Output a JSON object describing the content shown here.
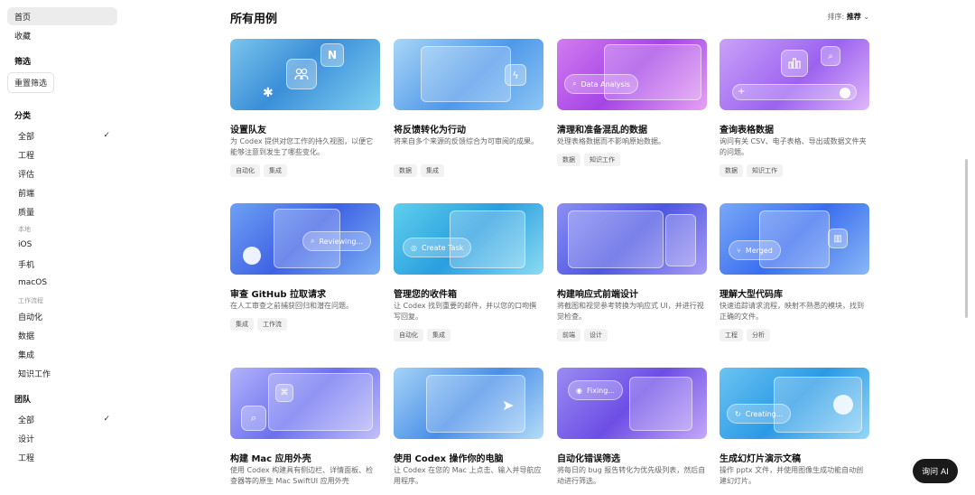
{
  "sidebar": {
    "home": "首页",
    "favorites": "收藏",
    "filter_title": "筛选",
    "reset_filter": "重置筛选",
    "category_title": "分类",
    "cat_all": "全部",
    "cat_engineering": "工程",
    "cat_eval": "评估",
    "cat_frontend": "前端",
    "cat_quality": "质量",
    "local_label": "本地",
    "ios": "iOS",
    "mobile": "手机",
    "macos": "macOS",
    "workflow_label": "工作流程",
    "automation": "自动化",
    "data": "数据",
    "integration": "集成",
    "knowledge": "知识工作",
    "team_title": "团队",
    "team_all": "全部",
    "design": "设计",
    "team_engineering": "工程",
    "check": "✓"
  },
  "header": {
    "title": "所有用例",
    "sort_label": "排序:",
    "sort_value": "推荐",
    "sort_chevron": "chevron-down-icon"
  },
  "cards": [
    {
      "title": "设置队友",
      "desc": "为 Codex 提供对您工作的持久视图，以便它能够注意到发生了哪些变化。",
      "tags": [
        "自动化",
        "集成"
      ]
    },
    {
      "title": "将反馈转化为行动",
      "desc": "将来自多个来源的反馈综合为可审阅的成果。",
      "tags": [
        "数据",
        "集成"
      ]
    },
    {
      "title": "清理和准备混乱的数据",
      "desc": "处理表格数据而不影响原始数据。",
      "tags": [
        "数据",
        "知识工作"
      ],
      "pill": "Data Analysis"
    },
    {
      "title": "查询表格数据",
      "desc": "询问有关 CSV、电子表格、导出或数据文件夹的问题。",
      "tags": [
        "数据",
        "知识工作"
      ]
    },
    {
      "title": "审查 GitHub 拉取请求",
      "desc": "在人工审查之前捕获回归和潜在问题。",
      "tags": [
        "集成",
        "工作流"
      ],
      "pill": "Reviewing..."
    },
    {
      "title": "管理您的收件箱",
      "desc": "让 Codex 找到重要的邮件，并以您的口吻撰写回复。",
      "tags": [
        "自动化",
        "集成"
      ],
      "pill": "Create Task"
    },
    {
      "title": "构建响应式前端设计",
      "desc": "将截图和视觉参考转换为响应式 UI，并进行视觉检查。",
      "tags": [
        "前端",
        "设计"
      ]
    },
    {
      "title": "理解大型代码库",
      "desc": "快速追踪请求流程，映射不熟悉的模块，找到正确的文件。",
      "tags": [
        "工程",
        "分析"
      ],
      "pill": "Merged"
    },
    {
      "title": "构建 Mac 应用外壳",
      "desc": "使用 Codex 构建具有侧边栏、详情面板、检查器等的原生 Mac SwiftUI 应用外壳",
      "tags": []
    },
    {
      "title": "使用 Codex 操作你的电脑",
      "desc": "让 Codex 在您的 Mac 上点击、输入并导航应用程序。",
      "tags": []
    },
    {
      "title": "自动化错误筛选",
      "desc": "将每日的 bug 报告转化为优先级列表，然后自动进行筛选。",
      "tags": [],
      "pill": "Fixing..."
    },
    {
      "title": "生成幻灯片演示文稿",
      "desc": "操作 pptx 文件，并使用图像生成功能自动创建幻灯片。",
      "tags": [],
      "pill": "Creating..."
    }
  ],
  "ask_ai": "询问 AI",
  "colors": {
    "thumb1": "#4aa3e0",
    "thumb2": "#3f8fe6",
    "thumb3": "#b04de8",
    "thumb4": "#a85cf0",
    "thumb5": "#3e6be8",
    "thumb6": "#2fb3e0",
    "thumb7": "#4f5fe6",
    "thumb8": "#3a6ef0",
    "thumb9": "#6a6cf0",
    "thumb10": "#4a8fe8",
    "thumb11": "#7b55ea",
    "thumb12": "#2aa0e8"
  }
}
